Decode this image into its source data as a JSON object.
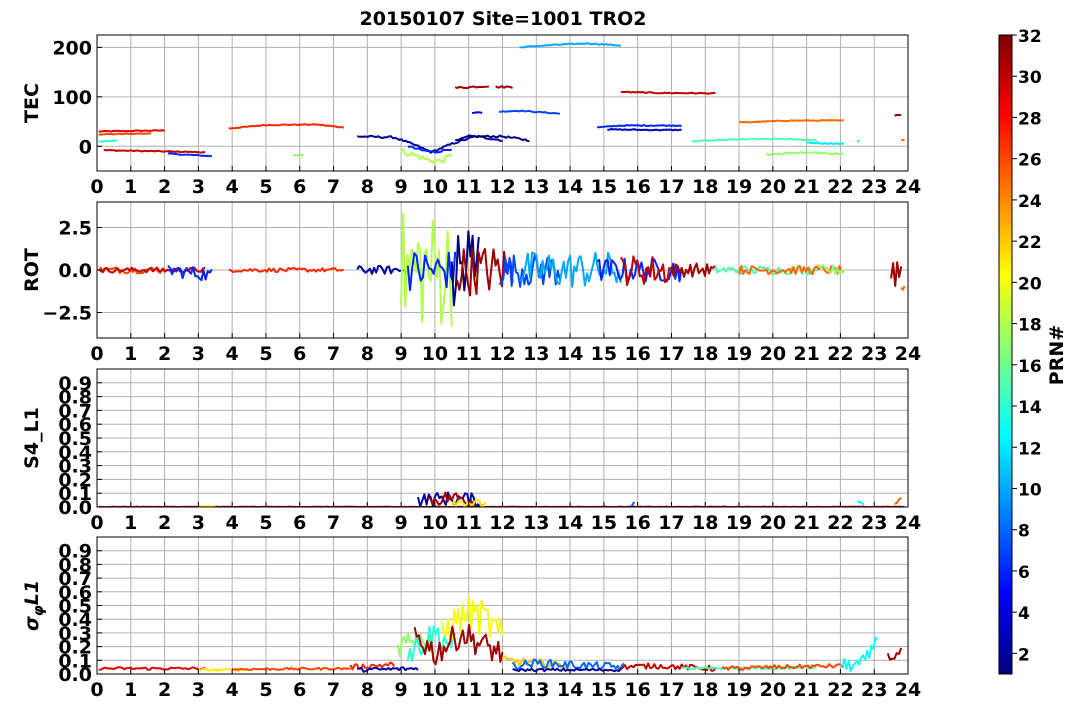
{
  "title": "20150107 Site=1001 TRO2",
  "colorbar": {
    "label": "PRN#",
    "min": 1,
    "max": 32,
    "ticks": [
      2,
      4,
      6,
      8,
      10,
      12,
      14,
      16,
      18,
      20,
      22,
      24,
      26,
      28,
      30,
      32
    ],
    "colormap": "jet"
  },
  "chart_data": [
    {
      "type": "line",
      "ylabel": "TEC",
      "xlim": [
        0,
        24
      ],
      "ylim": [
        -50,
        225
      ],
      "yticks": [
        0,
        100,
        200
      ],
      "xticks": [
        0,
        1,
        2,
        3,
        4,
        5,
        6,
        7,
        8,
        9,
        10,
        11,
        12,
        13,
        14,
        15,
        16,
        17,
        18,
        19,
        20,
        21,
        22,
        23,
        24
      ],
      "grid": true,
      "series": [
        {
          "prn": 29,
          "x": [
            0.05,
            2.0
          ],
          "y": [
            30,
            32
          ],
          "noise": 1
        },
        {
          "prn": 26,
          "x": [
            0.05,
            1.6
          ],
          "y": [
            24,
            26
          ],
          "noise": 1
        },
        {
          "prn": 14,
          "x": [
            0.05,
            0.6
          ],
          "y": [
            10,
            12
          ],
          "noise": 1
        },
        {
          "prn": 30,
          "x": [
            0.2,
            3.2
          ],
          "y": [
            -8,
            -12
          ],
          "noise": 1
        },
        {
          "prn": 6,
          "x": [
            2.1,
            3.4
          ],
          "y": [
            -15,
            -20
          ],
          "noise": 1
        },
        {
          "prn": 27,
          "x": [
            3.9,
            5.0,
            6.5,
            7.3
          ],
          "y": [
            36,
            43,
            44,
            38
          ],
          "noise": 1
        },
        {
          "prn": 17,
          "x": [
            5.8,
            6.1
          ],
          "y": [
            -18,
            -18
          ],
          "noise": 1
        },
        {
          "prn": 2,
          "x": [
            7.7,
            8.8,
            9.5,
            9.9,
            10.5,
            11.2,
            12.0
          ],
          "y": [
            20,
            18,
            0,
            -12,
            5,
            20,
            12
          ],
          "noise": 2
        },
        {
          "prn": 18,
          "x": [
            9.0,
            9.5,
            9.8,
            10.2,
            10.5
          ],
          "y": [
            -10,
            -20,
            -28,
            -30,
            -18
          ],
          "noise": 6
        },
        {
          "prn": 6,
          "x": [
            9.2,
            9.6,
            10.0,
            10.5
          ],
          "y": [
            0,
            -8,
            -12,
            -5
          ],
          "noise": 2
        },
        {
          "prn": 1,
          "x": [
            10.6,
            11.0,
            12.0,
            12.8
          ],
          "y": [
            10,
            20,
            20,
            12
          ],
          "noise": 2
        },
        {
          "prn": 31,
          "x": [
            10.6,
            11.6
          ],
          "y": [
            118,
            122
          ],
          "noise": 2
        },
        {
          "prn": 31,
          "x": [
            11.8,
            12.3
          ],
          "y": [
            120,
            120
          ],
          "noise": 2
        },
        {
          "prn": 5,
          "x": [
            11.1,
            11.4
          ],
          "y": [
            68,
            68
          ],
          "noise": 1
        },
        {
          "prn": 7,
          "x": [
            11.9,
            12.5,
            13.7
          ],
          "y": [
            70,
            72,
            66
          ],
          "noise": 1
        },
        {
          "prn": 10,
          "x": [
            12.5,
            13.5,
            14.5,
            15.5
          ],
          "y": [
            200,
            205,
            208,
            204
          ],
          "noise": 1
        },
        {
          "prn": 6,
          "x": [
            14.8,
            15.5,
            16.5,
            17.3
          ],
          "y": [
            38,
            42,
            42,
            42
          ],
          "noise": 1
        },
        {
          "prn": 3,
          "x": [
            15.1,
            16.5,
            17.3
          ],
          "y": [
            34,
            33,
            33
          ],
          "noise": 1
        },
        {
          "prn": 30,
          "x": [
            15.5,
            16.5,
            18.3
          ],
          "y": [
            110,
            108,
            107
          ],
          "noise": 1
        },
        {
          "prn": 15,
          "x": [
            17.6,
            19.0,
            20.5,
            21.3
          ],
          "y": [
            10,
            14,
            15,
            12
          ],
          "noise": 1
        },
        {
          "prn": 25,
          "x": [
            19.0,
            20.5,
            22.1
          ],
          "y": [
            48,
            52,
            52
          ],
          "noise": 1
        },
        {
          "prn": 17,
          "x": [
            19.8,
            21.0,
            22.1
          ],
          "y": [
            -16,
            -12,
            -16
          ],
          "noise": 2
        },
        {
          "prn": 12,
          "x": [
            21.0,
            21.5,
            22.1
          ],
          "y": [
            8,
            6,
            5
          ],
          "noise": 1
        },
        {
          "prn": 13,
          "x": [
            22.5,
            22.55
          ],
          "y": [
            10,
            12
          ],
          "noise": 1
        },
        {
          "prn": 31,
          "x": [
            23.6,
            23.8
          ],
          "y": [
            63,
            63
          ],
          "noise": 1
        },
        {
          "prn": 25,
          "x": [
            23.8,
            23.9
          ],
          "y": [
            13,
            13
          ],
          "noise": 1
        }
      ]
    },
    {
      "type": "line",
      "ylabel": "ROT",
      "xlim": [
        0,
        24
      ],
      "ylim": [
        -4,
        4
      ],
      "yticks": [
        -2.5,
        0.0,
        2.5
      ],
      "xticks": [
        0,
        1,
        2,
        3,
        4,
        5,
        6,
        7,
        8,
        9,
        10,
        11,
        12,
        13,
        14,
        15,
        16,
        17,
        18,
        19,
        20,
        21,
        22,
        23,
        24
      ],
      "grid": true,
      "series": [
        {
          "prn": 26,
          "x": [
            0.05,
            2.0
          ],
          "y": [
            0,
            0
          ],
          "noise": 0.2
        },
        {
          "prn": 30,
          "x": [
            0.1,
            3.2
          ],
          "y": [
            0,
            0
          ],
          "noise": 0.15
        },
        {
          "prn": 6,
          "x": [
            2.1,
            3.4
          ],
          "y": [
            0,
            -0.3
          ],
          "noise": 0.4
        },
        {
          "prn": 27,
          "x": [
            3.9,
            7.3
          ],
          "y": [
            0,
            0
          ],
          "noise": 0.12
        },
        {
          "prn": 2,
          "x": [
            7.7,
            9.2
          ],
          "y": [
            0,
            0
          ],
          "noise": 0.25
        },
        {
          "prn": 18,
          "x": [
            9.0,
            10.5
          ],
          "y": [
            0,
            0
          ],
          "noise": 3.5
        },
        {
          "prn": 6,
          "x": [
            9.2,
            10.6
          ],
          "y": [
            0,
            0
          ],
          "noise": 1.2
        },
        {
          "prn": 1,
          "x": [
            10.5,
            11.3
          ],
          "y": [
            0,
            0
          ],
          "noise": 3.5
        },
        {
          "prn": 31,
          "x": [
            10.6,
            12.3
          ],
          "y": [
            0,
            0
          ],
          "noise": 1.5
        },
        {
          "prn": 7,
          "x": [
            11.9,
            13.7
          ],
          "y": [
            0,
            0
          ],
          "noise": 1.0
        },
        {
          "prn": 10,
          "x": [
            12.5,
            15.5
          ],
          "y": [
            0,
            0
          ],
          "noise": 1.1
        },
        {
          "prn": 6,
          "x": [
            14.8,
            17.3
          ],
          "y": [
            0,
            0
          ],
          "noise": 0.7
        },
        {
          "prn": 30,
          "x": [
            15.5,
            17.0
          ],
          "y": [
            0,
            0
          ],
          "noise": 0.9
        },
        {
          "prn": 31,
          "x": [
            17.0,
            18.3
          ],
          "y": [
            0,
            0
          ],
          "noise": 0.4
        },
        {
          "prn": 15,
          "x": [
            18.3,
            21.3
          ],
          "y": [
            0,
            0
          ],
          "noise": 0.25
        },
        {
          "prn": 25,
          "x": [
            19.0,
            22.1
          ],
          "y": [
            0,
            0
          ],
          "noise": 0.25
        },
        {
          "prn": 17,
          "x": [
            21.3,
            22.1
          ],
          "y": [
            0,
            0
          ],
          "noise": 0.3
        },
        {
          "prn": 31,
          "x": [
            23.5,
            23.8
          ],
          "y": [
            0,
            0
          ],
          "noise": 1.2
        },
        {
          "prn": 25,
          "x": [
            23.8,
            23.9
          ],
          "y": [
            -1,
            -1
          ],
          "noise": 0.2
        }
      ]
    },
    {
      "type": "line",
      "ylabel": "S4_L1",
      "xlim": [
        0,
        24
      ],
      "ylim": [
        0,
        1.0
      ],
      "yticks": [
        0.0,
        0.1,
        0.2,
        0.3,
        0.4,
        0.5,
        0.6,
        0.7,
        0.8,
        0.9
      ],
      "xticks": [
        0,
        1,
        2,
        3,
        4,
        5,
        6,
        7,
        8,
        9,
        10,
        11,
        12,
        13,
        14,
        15,
        16,
        17,
        18,
        19,
        20,
        21,
        22,
        23,
        24
      ],
      "grid": true,
      "series": [
        {
          "prn": 31,
          "x": [
            0.05,
            23.9
          ],
          "y": [
            0.0,
            0.0
          ],
          "noise": 0.003
        },
        {
          "prn": 21,
          "x": [
            3.0,
            3.5
          ],
          "y": [
            0.005,
            0.005
          ],
          "noise": 0.003
        },
        {
          "prn": 2,
          "x": [
            9.5,
            10.2,
            11.0,
            11.4
          ],
          "y": [
            0.05,
            0.06,
            0.06,
            0.02
          ],
          "noise": 0.05
        },
        {
          "prn": 31,
          "x": [
            9.8,
            10.5,
            11.2
          ],
          "y": [
            0.05,
            0.07,
            0.04
          ],
          "noise": 0.05
        },
        {
          "prn": 21,
          "x": [
            10.5,
            11.5
          ],
          "y": [
            0.04,
            0.02
          ],
          "noise": 0.03
        },
        {
          "prn": 8,
          "x": [
            15.8,
            15.9
          ],
          "y": [
            0.02,
            0.02
          ],
          "noise": 0.02
        },
        {
          "prn": 13,
          "x": [
            22.5,
            22.7
          ],
          "y": [
            0.04,
            0.01
          ],
          "noise": 0.01
        },
        {
          "prn": 25,
          "x": [
            23.6,
            23.8
          ],
          "y": [
            0.02,
            0.06
          ],
          "noise": 0.01
        }
      ]
    },
    {
      "type": "line",
      "ylabel": "σ_φL1",
      "xlim": [
        0,
        24
      ],
      "ylim": [
        0,
        1.0
      ],
      "yticks": [
        0.0,
        0.1,
        0.2,
        0.3,
        0.4,
        0.5,
        0.6,
        0.7,
        0.8,
        0.9
      ],
      "xticks": [
        0,
        1,
        2,
        3,
        4,
        5,
        6,
        7,
        8,
        9,
        10,
        11,
        12,
        13,
        14,
        15,
        16,
        17,
        18,
        19,
        20,
        21,
        22,
        23,
        24
      ],
      "grid": true,
      "series": [
        {
          "prn": 29,
          "x": [
            0.05,
            3.2
          ],
          "y": [
            0.04,
            0.04
          ],
          "noise": 0.01
        },
        {
          "prn": 21,
          "x": [
            3.0,
            4.5
          ],
          "y": [
            0.03,
            0.03
          ],
          "noise": 0.008
        },
        {
          "prn": 26,
          "x": [
            4.0,
            7.5
          ],
          "y": [
            0.035,
            0.04
          ],
          "noise": 0.008
        },
        {
          "prn": 27,
          "x": [
            7.5,
            8.8
          ],
          "y": [
            0.05,
            0.07
          ],
          "noise": 0.02
        },
        {
          "prn": 2,
          "x": [
            7.7,
            9.5
          ],
          "y": [
            0.03,
            0.04
          ],
          "noise": 0.015
        },
        {
          "prn": 17,
          "x": [
            8.9,
            9.5,
            10.0
          ],
          "y": [
            0.2,
            0.3,
            0.2
          ],
          "noise": 0.08
        },
        {
          "prn": 14,
          "x": [
            9.2,
            10.0,
            10.6
          ],
          "y": [
            0.15,
            0.3,
            0.2
          ],
          "noise": 0.1
        },
        {
          "prn": 20,
          "x": [
            10.2,
            11.0,
            11.5,
            12.0
          ],
          "y": [
            0.3,
            0.45,
            0.4,
            0.25
          ],
          "noise": 0.13
        },
        {
          "prn": 31,
          "x": [
            9.4,
            10.0,
            10.8,
            11.5,
            12.0
          ],
          "y": [
            0.3,
            0.15,
            0.3,
            0.2,
            0.15
          ],
          "noise": 0.1
        },
        {
          "prn": 22,
          "x": [
            12.0,
            13.0,
            14.0
          ],
          "y": [
            0.1,
            0.08,
            0.06
          ],
          "noise": 0.03
        },
        {
          "prn": 8,
          "x": [
            12.3,
            13.0,
            14.5,
            15.6
          ],
          "y": [
            0.06,
            0.08,
            0.06,
            0.05
          ],
          "noise": 0.03
        },
        {
          "prn": 2,
          "x": [
            12.3,
            15.5
          ],
          "y": [
            0.03,
            0.03
          ],
          "noise": 0.01
        },
        {
          "prn": 30,
          "x": [
            15.5,
            16.5,
            18.3
          ],
          "y": [
            0.05,
            0.06,
            0.04
          ],
          "noise": 0.02
        },
        {
          "prn": 15,
          "x": [
            17.3,
            19.0,
            21.3
          ],
          "y": [
            0.04,
            0.04,
            0.05
          ],
          "noise": 0.01
        },
        {
          "prn": 26,
          "x": [
            18.5,
            20.0,
            22.1
          ],
          "y": [
            0.04,
            0.05,
            0.06
          ],
          "noise": 0.015
        },
        {
          "prn": 13,
          "x": [
            22.0,
            22.6,
            22.9,
            23.1
          ],
          "y": [
            0.06,
            0.07,
            0.15,
            0.3
          ],
          "noise": 0.05
        },
        {
          "prn": 31,
          "x": [
            23.4,
            23.8
          ],
          "y": [
            0.12,
            0.15
          ],
          "noise": 0.04
        }
      ]
    }
  ]
}
